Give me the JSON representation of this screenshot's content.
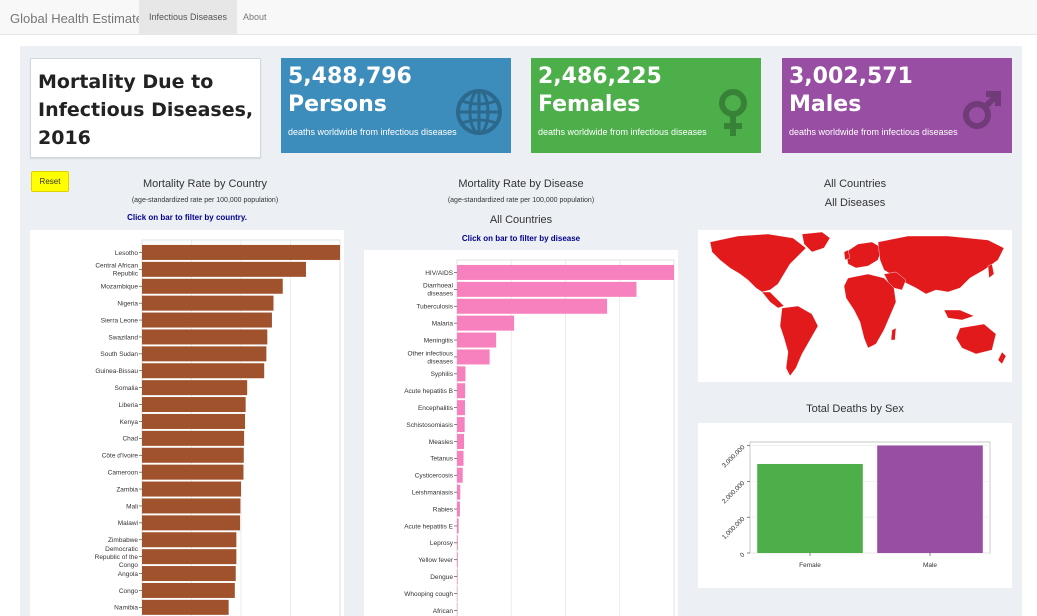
{
  "navbar": {
    "brand": "Global Health Estimates",
    "tabs": [
      "Infectious Diseases",
      "About"
    ]
  },
  "title": [
    "Mortality Due to",
    "Infectious Diseases,",
    "2016"
  ],
  "value_boxes": [
    {
      "number": "5,488,796",
      "label": "Persons",
      "subtitle": "deaths worldwide from infectious diseases",
      "color": "#3c8dbc",
      "icon": "globe-icon"
    },
    {
      "number": "2,486,225",
      "label": "Females",
      "subtitle": "deaths worldwide from infectious diseases",
      "color": "#4caf4a",
      "icon": "female-symbol-icon"
    },
    {
      "number": "3,002,571",
      "label": "Males",
      "subtitle": "deaths worldwide from infectious diseases",
      "color": "#984ea3",
      "icon": "male-symbol-icon"
    }
  ],
  "reset_label": "Reset",
  "country_panel": {
    "title": "Mortality Rate by Country",
    "subtitle": "(age-standardized rate per 100,000 population)",
    "hint": "Click on bar to filter by country."
  },
  "disease_panel": {
    "title": "Mortality Rate by Disease",
    "subtitle": "(age-standardized rate per 100,000 population)",
    "filter": "All Countries",
    "hint": "Click on bar to filter by disease"
  },
  "map_panel": {
    "line1": "All Countries",
    "line2": "All Diseases",
    "fill_color": "#e31a1c"
  },
  "sex_panel": {
    "title": "Total Deaths by Sex"
  },
  "chart_data": [
    {
      "type": "bar",
      "orientation": "horizontal",
      "color": "#a0522d",
      "categories": [
        "Lesotho",
        "Central African Republic",
        "Mozambique",
        "Nigeria",
        "Sierra Leone",
        "Swaziland",
        "South Sudan",
        "Guinea-Bissau",
        "Somalia",
        "Liberia",
        "Kenya",
        "Chad",
        "Côte d'Ivoire",
        "Cameroon",
        "Zambia",
        "Mali",
        "Malawi",
        "Zimbabwe",
        "Democratic Republic of the Congo",
        "Angola",
        "Congo",
        "Namibia"
      ],
      "values": [
        640,
        530,
        455,
        425,
        420,
        405,
        402,
        395,
        340,
        335,
        333,
        330,
        329,
        328,
        320,
        318,
        317,
        305,
        305,
        303,
        300,
        280
      ],
      "xlim": [
        0,
        640
      ]
    },
    {
      "type": "bar",
      "orientation": "horizontal",
      "color": "#f781bf",
      "categories": [
        "HIV/AIDS",
        "Diarrhoeal diseases",
        "Tuberculosis",
        "Malaria",
        "Meningitis",
        "Other infectious diseases",
        "Syphilis",
        "Acute hepatitis B",
        "Encephalitis",
        "Schistosomiasis",
        "Measles",
        "Tetanus",
        "Cysticercosis",
        "Leishmaniasis",
        "Rabies",
        "Acute hepatitis E",
        "Leprosy",
        "Yellow fever",
        "Dengue",
        "Whooping cough",
        "African"
      ],
      "values": [
        13.3,
        11.0,
        9.2,
        3.5,
        2.4,
        2.0,
        0.52,
        0.5,
        0.49,
        0.47,
        0.43,
        0.4,
        0.35,
        0.2,
        0.18,
        0.1,
        0.05,
        0.05,
        0.04,
        0.03,
        0.03
      ],
      "xlim": [
        0,
        13.3
      ]
    },
    {
      "type": "bar",
      "categories": [
        "Female",
        "Male"
      ],
      "values": [
        2486225,
        3002571
      ],
      "colors": [
        "#4caf4a",
        "#984ea3"
      ],
      "yticks": [
        "0",
        "1,000,000",
        "2,000,000",
        "3,000,000"
      ],
      "ylim": [
        0,
        3100000
      ]
    }
  ]
}
